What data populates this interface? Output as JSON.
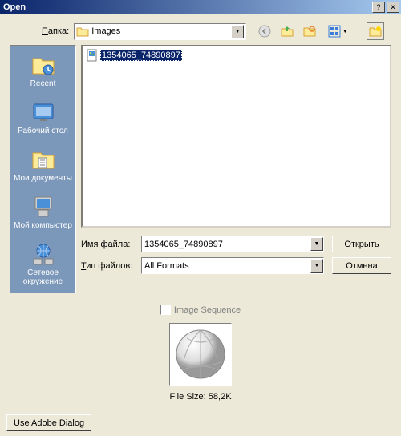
{
  "title": "Open",
  "folder_label": "Папка:",
  "folder_label_u": "П",
  "current_folder": "Images",
  "sidebar": {
    "items": [
      {
        "label": "Recent"
      },
      {
        "label": "Рабочий стол"
      },
      {
        "label": "Мои документы"
      },
      {
        "label": "Мой компьютер"
      },
      {
        "label": "Сетевое окружение"
      }
    ]
  },
  "file_list": {
    "items": [
      {
        "name": "1354065_74890897",
        "selected": true
      }
    ]
  },
  "form": {
    "filename_label": "Имя файла:",
    "filename_u": "И",
    "filename_value": "1354065_74890897",
    "filetype_label": "Тип файлов:",
    "filetype_u": "Т",
    "filetype_value": "All Formats"
  },
  "buttons": {
    "open": "Открыть",
    "open_u": "О",
    "cancel": "Отмена",
    "adobe": "Use Adobe Dialog"
  },
  "image_sequence_label": "Image Sequence",
  "file_size_label": "File Size:",
  "file_size_value": "58,2K"
}
